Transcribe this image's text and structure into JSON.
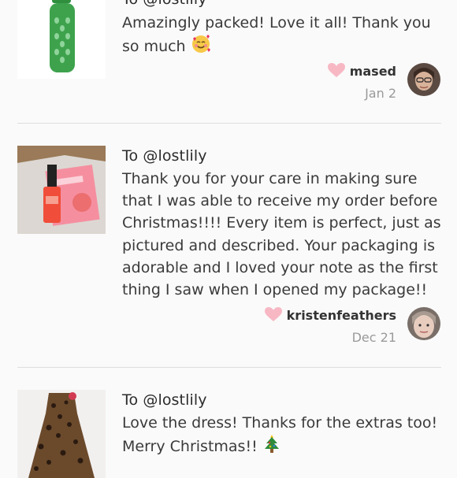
{
  "reviews": [
    {
      "to": "To @lostlily",
      "text": "Amazingly packed! Love it all! Thank you so much",
      "emoji": "smiling-face-with-hearts",
      "username": "mased",
      "date": "Jan 2"
    },
    {
      "to": "To @lostlily",
      "text": "Thank you for your care in making sure that I was able to receive my order before Christmas!!!! Every item is perfect, just as pictured and described. Your packaging is adorable and I loved your note as the first thing I saw when I opened my package!!",
      "username": "kristenfeathers",
      "date": "Dec 21"
    },
    {
      "to": "To @lostlily",
      "text": "Love the dress! Thanks for the extras too! Merry Christmas!!",
      "emoji": "christmas-tree"
    }
  ],
  "colors": {
    "heart": "#f7b8c4",
    "divider": "#dedede",
    "muted": "#9a9a9a",
    "background": "#fafafa"
  }
}
